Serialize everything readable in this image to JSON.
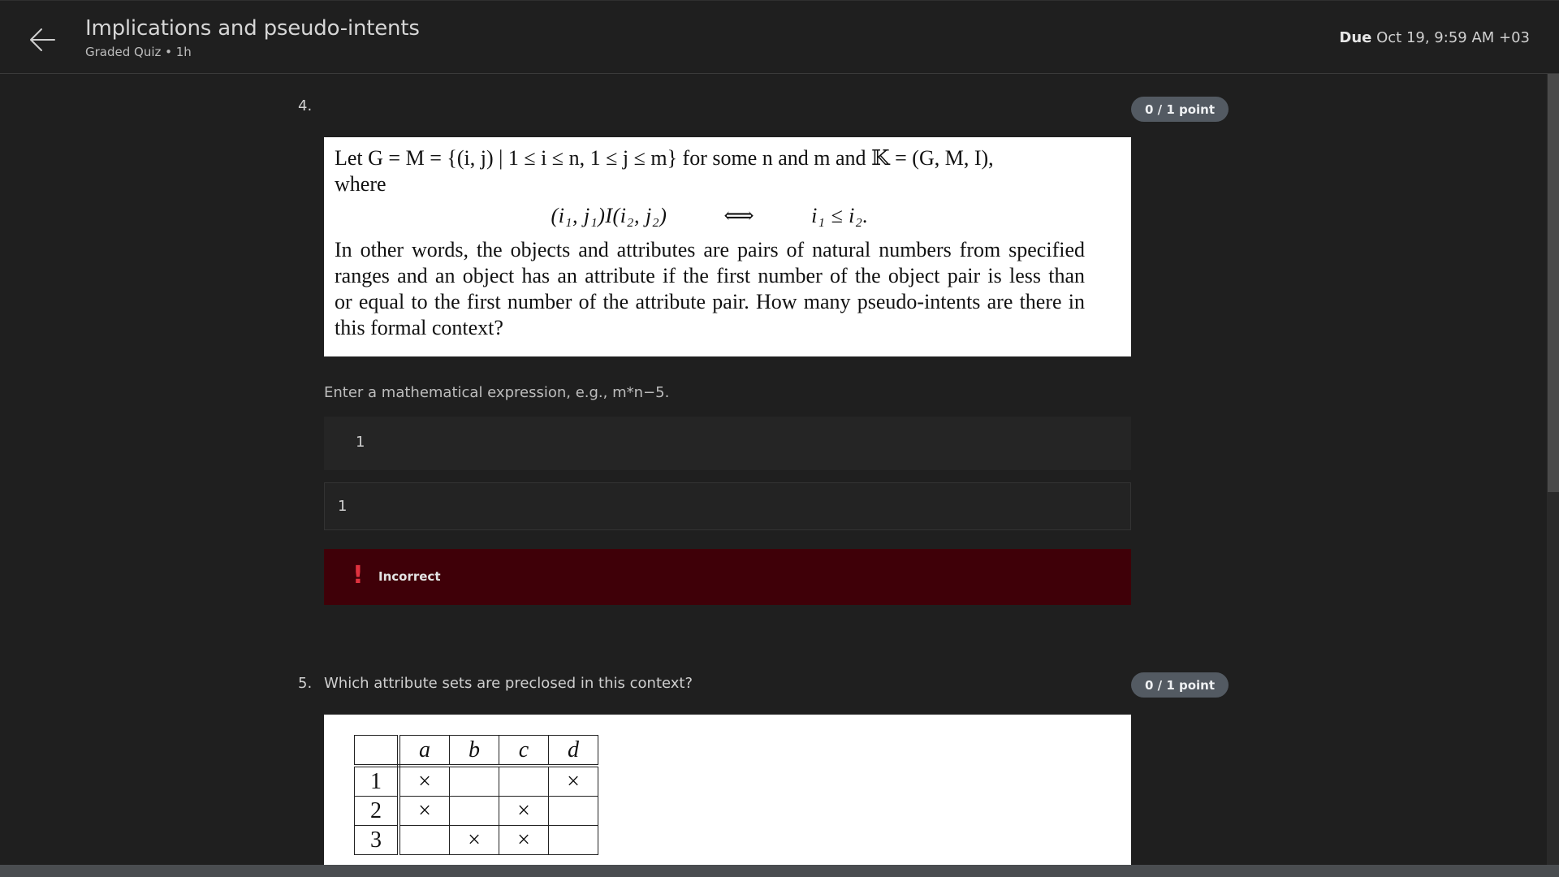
{
  "header": {
    "title": "Implications and pseudo-intents",
    "subtitle": "Graded Quiz • 1h",
    "due_label": "Due",
    "due_value": "Oct 19, 9:59 AM +03"
  },
  "questions": [
    {
      "number": "4.",
      "points": "0 / 1 point",
      "image_text": {
        "line1": "Let G = M = {(i, j) | 1 ≤ i ≤ n, 1 ≤ j ≤ m} for some n and m and 𝕂 = (G, M, I),",
        "line2": "where",
        "formula": "(i₁, j₁)I(i₂, j₂)          ⟺          i₁ ≤ i₂.",
        "para_lines": [
          "In other words, the objects and attributes are pairs of natural numbers from specified",
          "ranges and an object has an attribute if the first number of the object pair is less than",
          "or equal to the first number of the attribute pair. How many pseudo-intents are there in",
          "this formal context?"
        ]
      },
      "hint": "Enter a mathematical expression, e.g., m*n−5.",
      "editor_value": "1",
      "preview_value": "1",
      "feedback": "Incorrect"
    },
    {
      "number": "5.",
      "text": "Which attribute sets are preclosed in this context?",
      "points": "0 / 1 point",
      "context_table": {
        "columns": [
          "a",
          "b",
          "c",
          "d"
        ],
        "rows": [
          {
            "label": "1",
            "cells": [
              "×",
              "",
              "",
              "×"
            ]
          },
          {
            "label": "2",
            "cells": [
              "×",
              "",
              "×",
              ""
            ]
          },
          {
            "label": "3",
            "cells": [
              "",
              "×",
              "×",
              ""
            ]
          }
        ]
      }
    }
  ],
  "icons": {
    "back": "arrow-left-icon",
    "feedback": "exclamation-icon"
  }
}
